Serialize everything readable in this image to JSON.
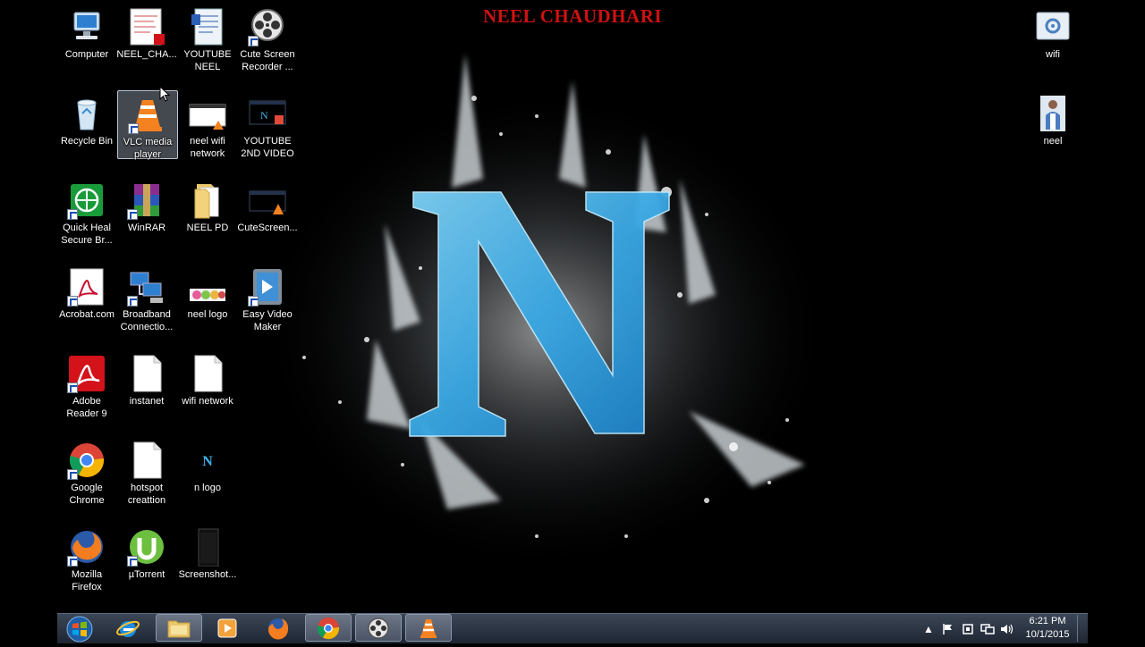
{
  "wallpaper": {
    "title": "NEEL CHAUDHARI"
  },
  "desktop_icons": [
    {
      "label": "Computer"
    },
    {
      "label": "NEEL_CHA..."
    },
    {
      "label": "YOUTUBE\nNEEL"
    },
    {
      "label": "Cute Screen\nRecorder ..."
    },
    {
      "label": "Recycle Bin"
    },
    {
      "label": "VLC media\nplayer"
    },
    {
      "label": "neel wifi\nnetwork"
    },
    {
      "label": "YOUTUBE\n2ND VIDEO"
    },
    {
      "label": "Quick Heal\nSecure Br..."
    },
    {
      "label": "WinRAR"
    },
    {
      "label": "NEEL PD"
    },
    {
      "label": "CuteScreen..."
    },
    {
      "label": "Acrobat.com"
    },
    {
      "label": "Broadband\nConnectio..."
    },
    {
      "label": "neel logo"
    },
    {
      "label": "Easy Video\nMaker"
    },
    {
      "label": "Adobe\nReader 9"
    },
    {
      "label": "instanet"
    },
    {
      "label": "wifi network"
    },
    {
      "label": "Google\nChrome"
    },
    {
      "label": "hotspot\ncreattion"
    },
    {
      "label": "n logo"
    },
    {
      "label": "Mozilla\nFirefox"
    },
    {
      "label": "µTorrent"
    },
    {
      "label": "Screenshot..."
    },
    {
      "label": "wifi"
    },
    {
      "label": "neel"
    }
  ],
  "taskbar": {
    "pinned": [
      "internet-explorer-icon",
      "file-explorer-icon",
      "media-player-icon",
      "firefox-icon",
      "chrome-icon",
      "cute-screen-recorder-icon",
      "vlc-icon"
    ]
  },
  "clock": {
    "time": "6:21 PM",
    "date": "10/1/2015"
  },
  "colors": {
    "title": "#cc1111",
    "n_letter": "#3fb3ea",
    "taskbar": "#2a3342"
  }
}
